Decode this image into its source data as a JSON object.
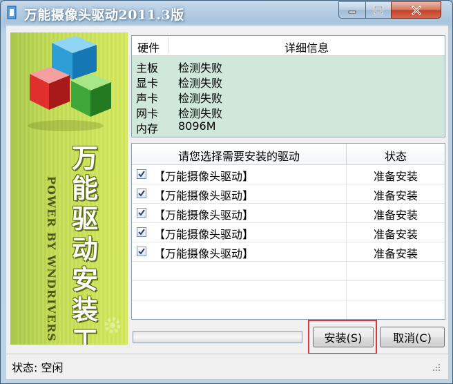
{
  "window": {
    "title": "万能摄像头驱动2011.3版",
    "minimize_label": "minimize",
    "maximize_label": "maximize",
    "close_label": "close"
  },
  "banner": {
    "title": "万能驱动安装工具",
    "subtitle": "POWER BY WNDRIVERS"
  },
  "hardware": {
    "columns": [
      "硬件",
      "详细信息"
    ],
    "rows": [
      {
        "name": "主板",
        "detail": "检测失败"
      },
      {
        "name": "显卡",
        "detail": "检测失败"
      },
      {
        "name": "声卡",
        "detail": "检测失败"
      },
      {
        "name": "网卡",
        "detail": "检测失败"
      },
      {
        "name": "内存",
        "detail": "8096M"
      }
    ]
  },
  "drivers": {
    "columns": [
      "请您选择需要安装的驱动",
      "状态"
    ],
    "rows": [
      {
        "name": "【万能摄像头驱动】",
        "status": "准备安装",
        "checked": true
      },
      {
        "name": "【万能摄像头驱动】",
        "status": "准备安装",
        "checked": true
      },
      {
        "name": "【万能摄像头驱动】",
        "status": "准备安装",
        "checked": true
      },
      {
        "name": "【万能摄像头驱动】",
        "status": "准备安装",
        "checked": true
      },
      {
        "name": "【万能摄像头驱动】",
        "status": "准备安装",
        "checked": true
      }
    ]
  },
  "progress": {
    "value": 0
  },
  "buttons": {
    "install": "安装(S)",
    "cancel": "取消(C)"
  },
  "statusbar": {
    "text": "状态: 空闲"
  },
  "colors": {
    "highlight": "#e0303a",
    "info_bg": "#cfe8d9",
    "banner_green": "#c4dd55"
  }
}
